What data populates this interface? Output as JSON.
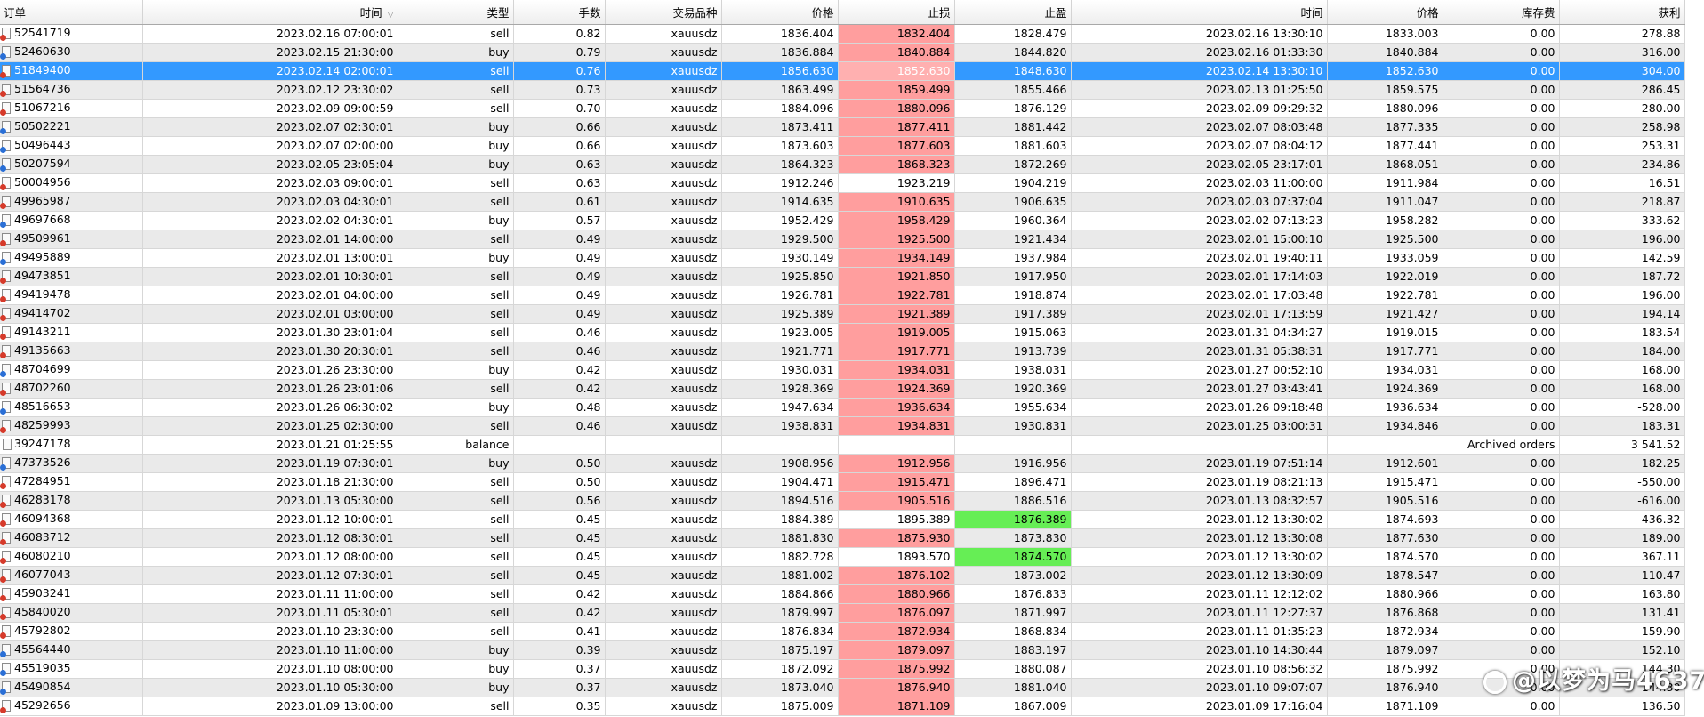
{
  "columns": [
    {
      "key": "order",
      "label": "订单"
    },
    {
      "key": "time",
      "label": "时间",
      "sort_icon": "sort-descending-icon"
    },
    {
      "key": "type",
      "label": "类型"
    },
    {
      "key": "lots",
      "label": "手数"
    },
    {
      "key": "symbol",
      "label": "交易品种"
    },
    {
      "key": "open_price",
      "label": "价格"
    },
    {
      "key": "sl",
      "label": "止损"
    },
    {
      "key": "tp",
      "label": "止盈"
    },
    {
      "key": "close_time",
      "label": "时间"
    },
    {
      "key": "close_price",
      "label": "价格"
    },
    {
      "key": "swap",
      "label": "库存费"
    },
    {
      "key": "profit",
      "label": "获利"
    }
  ],
  "colors": {
    "selected_row": "#3399ff",
    "stop_loss_hit": "#ff9e9e",
    "take_profit_hit": "#66ee55",
    "alternate_row": "#eaeaea"
  },
  "rows": [
    {
      "order": "52541719",
      "time": "2023.02.16 07:00:01",
      "type": "sell",
      "lots": "0.82",
      "symbol": "xauusdz",
      "open_price": "1836.404",
      "sl": "1832.404",
      "tp": "1828.479",
      "close_time": "2023.02.16 13:30:10",
      "close_price": "1833.003",
      "swap": "0.00",
      "profit": "278.88",
      "hit": "sl"
    },
    {
      "order": "52460630",
      "time": "2023.02.15 21:30:00",
      "type": "buy",
      "lots": "0.79",
      "symbol": "xauusdz",
      "open_price": "1836.884",
      "sl": "1840.884",
      "tp": "1844.820",
      "close_time": "2023.02.16 01:33:30",
      "close_price": "1840.884",
      "swap": "0.00",
      "profit": "316.00",
      "hit": "sl"
    },
    {
      "order": "51849400",
      "time": "2023.02.14 02:00:01",
      "type": "sell",
      "lots": "0.76",
      "symbol": "xauusdz",
      "open_price": "1856.630",
      "sl": "1852.630",
      "tp": "1848.630",
      "close_time": "2023.02.14 13:30:10",
      "close_price": "1852.630",
      "swap": "0.00",
      "profit": "304.00",
      "hit": "sl",
      "selected": true
    },
    {
      "order": "51564736",
      "time": "2023.02.12 23:30:02",
      "type": "sell",
      "lots": "0.73",
      "symbol": "xauusdz",
      "open_price": "1863.499",
      "sl": "1859.499",
      "tp": "1855.466",
      "close_time": "2023.02.13 01:25:50",
      "close_price": "1859.575",
      "swap": "0.00",
      "profit": "286.45",
      "hit": "sl"
    },
    {
      "order": "51067216",
      "time": "2023.02.09 09:00:59",
      "type": "sell",
      "lots": "0.70",
      "symbol": "xauusdz",
      "open_price": "1884.096",
      "sl": "1880.096",
      "tp": "1876.129",
      "close_time": "2023.02.09 09:29:32",
      "close_price": "1880.096",
      "swap": "0.00",
      "profit": "280.00",
      "hit": "sl"
    },
    {
      "order": "50502221",
      "time": "2023.02.07 02:30:01",
      "type": "buy",
      "lots": "0.66",
      "symbol": "xauusdz",
      "open_price": "1873.411",
      "sl": "1877.411",
      "tp": "1881.442",
      "close_time": "2023.02.07 08:03:48",
      "close_price": "1877.335",
      "swap": "0.00",
      "profit": "258.98",
      "hit": "sl"
    },
    {
      "order": "50496443",
      "time": "2023.02.07 02:00:00",
      "type": "buy",
      "lots": "0.66",
      "symbol": "xauusdz",
      "open_price": "1873.603",
      "sl": "1877.603",
      "tp": "1881.603",
      "close_time": "2023.02.07 08:04:12",
      "close_price": "1877.441",
      "swap": "0.00",
      "profit": "253.31",
      "hit": "sl"
    },
    {
      "order": "50207594",
      "time": "2023.02.05 23:05:04",
      "type": "buy",
      "lots": "0.63",
      "symbol": "xauusdz",
      "open_price": "1864.323",
      "sl": "1868.323",
      "tp": "1872.269",
      "close_time": "2023.02.05 23:17:01",
      "close_price": "1868.051",
      "swap": "0.00",
      "profit": "234.86",
      "hit": "sl"
    },
    {
      "order": "50004956",
      "time": "2023.02.03 09:00:01",
      "type": "sell",
      "lots": "0.63",
      "symbol": "xauusdz",
      "open_price": "1912.246",
      "sl": "1923.219",
      "tp": "1904.219",
      "close_time": "2023.02.03 11:00:00",
      "close_price": "1911.984",
      "swap": "0.00",
      "profit": "16.51",
      "hit": ""
    },
    {
      "order": "49965987",
      "time": "2023.02.03 04:30:01",
      "type": "sell",
      "lots": "0.61",
      "symbol": "xauusdz",
      "open_price": "1914.635",
      "sl": "1910.635",
      "tp": "1906.635",
      "close_time": "2023.02.03 07:37:04",
      "close_price": "1911.047",
      "swap": "0.00",
      "profit": "218.87",
      "hit": "sl"
    },
    {
      "order": "49697668",
      "time": "2023.02.02 04:30:01",
      "type": "buy",
      "lots": "0.57",
      "symbol": "xauusdz",
      "open_price": "1952.429",
      "sl": "1958.429",
      "tp": "1960.364",
      "close_time": "2023.02.02 07:13:23",
      "close_price": "1958.282",
      "swap": "0.00",
      "profit": "333.62",
      "hit": "sl"
    },
    {
      "order": "49509961",
      "time": "2023.02.01 14:00:00",
      "type": "sell",
      "lots": "0.49",
      "symbol": "xauusdz",
      "open_price": "1929.500",
      "sl": "1925.500",
      "tp": "1921.434",
      "close_time": "2023.02.01 15:00:10",
      "close_price": "1925.500",
      "swap": "0.00",
      "profit": "196.00",
      "hit": "sl"
    },
    {
      "order": "49495889",
      "time": "2023.02.01 13:00:01",
      "type": "buy",
      "lots": "0.49",
      "symbol": "xauusdz",
      "open_price": "1930.149",
      "sl": "1934.149",
      "tp": "1937.984",
      "close_time": "2023.02.01 19:40:11",
      "close_price": "1933.059",
      "swap": "0.00",
      "profit": "142.59",
      "hit": "sl"
    },
    {
      "order": "49473851",
      "time": "2023.02.01 10:30:01",
      "type": "sell",
      "lots": "0.49",
      "symbol": "xauusdz",
      "open_price": "1925.850",
      "sl": "1921.850",
      "tp": "1917.950",
      "close_time": "2023.02.01 17:14:03",
      "close_price": "1922.019",
      "swap": "0.00",
      "profit": "187.72",
      "hit": "sl"
    },
    {
      "order": "49419478",
      "time": "2023.02.01 04:00:00",
      "type": "sell",
      "lots": "0.49",
      "symbol": "xauusdz",
      "open_price": "1926.781",
      "sl": "1922.781",
      "tp": "1918.874",
      "close_time": "2023.02.01 17:03:48",
      "close_price": "1922.781",
      "swap": "0.00",
      "profit": "196.00",
      "hit": "sl"
    },
    {
      "order": "49414702",
      "time": "2023.02.01 03:00:00",
      "type": "sell",
      "lots": "0.49",
      "symbol": "xauusdz",
      "open_price": "1925.389",
      "sl": "1921.389",
      "tp": "1917.389",
      "close_time": "2023.02.01 17:13:59",
      "close_price": "1921.427",
      "swap": "0.00",
      "profit": "194.14",
      "hit": "sl"
    },
    {
      "order": "49143211",
      "time": "2023.01.30 23:01:04",
      "type": "sell",
      "lots": "0.46",
      "symbol": "xauusdz",
      "open_price": "1923.005",
      "sl": "1919.005",
      "tp": "1915.063",
      "close_time": "2023.01.31 04:34:27",
      "close_price": "1919.015",
      "swap": "0.00",
      "profit": "183.54",
      "hit": "sl"
    },
    {
      "order": "49135663",
      "time": "2023.01.30 20:30:01",
      "type": "sell",
      "lots": "0.46",
      "symbol": "xauusdz",
      "open_price": "1921.771",
      "sl": "1917.771",
      "tp": "1913.739",
      "close_time": "2023.01.31 05:38:31",
      "close_price": "1917.771",
      "swap": "0.00",
      "profit": "184.00",
      "hit": "sl"
    },
    {
      "order": "48704699",
      "time": "2023.01.26 23:30:00",
      "type": "buy",
      "lots": "0.42",
      "symbol": "xauusdz",
      "open_price": "1930.031",
      "sl": "1934.031",
      "tp": "1938.031",
      "close_time": "2023.01.27 00:52:10",
      "close_price": "1934.031",
      "swap": "0.00",
      "profit": "168.00",
      "hit": "sl"
    },
    {
      "order": "48702260",
      "time": "2023.01.26 23:01:06",
      "type": "sell",
      "lots": "0.42",
      "symbol": "xauusdz",
      "open_price": "1928.369",
      "sl": "1924.369",
      "tp": "1920.369",
      "close_time": "2023.01.27 03:43:41",
      "close_price": "1924.369",
      "swap": "0.00",
      "profit": "168.00",
      "hit": "sl"
    },
    {
      "order": "48516653",
      "time": "2023.01.26 06:30:02",
      "type": "buy",
      "lots": "0.48",
      "symbol": "xauusdz",
      "open_price": "1947.634",
      "sl": "1936.634",
      "tp": "1955.634",
      "close_time": "2023.01.26 09:18:48",
      "close_price": "1936.634",
      "swap": "0.00",
      "profit": "-528.00",
      "hit": "sl"
    },
    {
      "order": "48259993",
      "time": "2023.01.25 02:30:00",
      "type": "sell",
      "lots": "0.46",
      "symbol": "xauusdz",
      "open_price": "1938.831",
      "sl": "1934.831",
      "tp": "1930.831",
      "close_time": "2023.01.25 03:00:31",
      "close_price": "1934.846",
      "swap": "0.00",
      "profit": "183.31",
      "hit": "sl"
    },
    {
      "order": "39247178",
      "time": "2023.01.21 01:25:55",
      "type": "balance",
      "lots": "",
      "symbol": "",
      "open_price": "",
      "sl": "",
      "tp": "",
      "close_time": "",
      "close_price": "",
      "swap": "Archived orders",
      "profit": "3 541.52",
      "hit": ""
    },
    {
      "order": "47373526",
      "time": "2023.01.19 07:30:01",
      "type": "buy",
      "lots": "0.50",
      "symbol": "xauusdz",
      "open_price": "1908.956",
      "sl": "1912.956",
      "tp": "1916.956",
      "close_time": "2023.01.19 07:51:14",
      "close_price": "1912.601",
      "swap": "0.00",
      "profit": "182.25",
      "hit": "sl"
    },
    {
      "order": "47284951",
      "time": "2023.01.18 21:30:00",
      "type": "sell",
      "lots": "0.50",
      "symbol": "xauusdz",
      "open_price": "1904.471",
      "sl": "1915.471",
      "tp": "1896.471",
      "close_time": "2023.01.19 08:21:13",
      "close_price": "1915.471",
      "swap": "0.00",
      "profit": "-550.00",
      "hit": "sl"
    },
    {
      "order": "46283178",
      "time": "2023.01.13 05:30:00",
      "type": "sell",
      "lots": "0.56",
      "symbol": "xauusdz",
      "open_price": "1894.516",
      "sl": "1905.516",
      "tp": "1886.516",
      "close_time": "2023.01.13 08:32:57",
      "close_price": "1905.516",
      "swap": "0.00",
      "profit": "-616.00",
      "hit": "sl"
    },
    {
      "order": "46094368",
      "time": "2023.01.12 10:00:01",
      "type": "sell",
      "lots": "0.45",
      "symbol": "xauusdz",
      "open_price": "1884.389",
      "sl": "1895.389",
      "tp": "1876.389",
      "close_time": "2023.01.12 13:30:02",
      "close_price": "1874.693",
      "swap": "0.00",
      "profit": "436.32",
      "hit": "tp"
    },
    {
      "order": "46083712",
      "time": "2023.01.12 08:30:01",
      "type": "sell",
      "lots": "0.45",
      "symbol": "xauusdz",
      "open_price": "1881.830",
      "sl": "1875.930",
      "tp": "1873.830",
      "close_time": "2023.01.12 13:30:08",
      "close_price": "1877.630",
      "swap": "0.00",
      "profit": "189.00",
      "hit": "sl"
    },
    {
      "order": "46080210",
      "time": "2023.01.12 08:00:00",
      "type": "sell",
      "lots": "0.45",
      "symbol": "xauusdz",
      "open_price": "1882.728",
      "sl": "1893.570",
      "tp": "1874.570",
      "close_time": "2023.01.12 13:30:02",
      "close_price": "1874.570",
      "swap": "0.00",
      "profit": "367.11",
      "hit": "tp"
    },
    {
      "order": "46077043",
      "time": "2023.01.12 07:30:01",
      "type": "sell",
      "lots": "0.45",
      "symbol": "xauusdz",
      "open_price": "1881.002",
      "sl": "1876.102",
      "tp": "1873.002",
      "close_time": "2023.01.12 13:30:09",
      "close_price": "1878.547",
      "swap": "0.00",
      "profit": "110.47",
      "hit": "sl"
    },
    {
      "order": "45903241",
      "time": "2023.01.11 11:00:00",
      "type": "sell",
      "lots": "0.42",
      "symbol": "xauusdz",
      "open_price": "1884.866",
      "sl": "1880.966",
      "tp": "1876.833",
      "close_time": "2023.01.11 12:12:02",
      "close_price": "1880.966",
      "swap": "0.00",
      "profit": "163.80",
      "hit": "sl"
    },
    {
      "order": "45840020",
      "time": "2023.01.11 05:30:01",
      "type": "sell",
      "lots": "0.42",
      "symbol": "xauusdz",
      "open_price": "1879.997",
      "sl": "1876.097",
      "tp": "1871.997",
      "close_time": "2023.01.11 12:27:37",
      "close_price": "1876.868",
      "swap": "0.00",
      "profit": "131.41",
      "hit": "sl"
    },
    {
      "order": "45792802",
      "time": "2023.01.10 23:30:00",
      "type": "sell",
      "lots": "0.41",
      "symbol": "xauusdz",
      "open_price": "1876.834",
      "sl": "1872.934",
      "tp": "1868.834",
      "close_time": "2023.01.11 01:35:23",
      "close_price": "1872.934",
      "swap": "0.00",
      "profit": "159.90",
      "hit": "sl"
    },
    {
      "order": "45564440",
      "time": "2023.01.10 11:00:00",
      "type": "buy",
      "lots": "0.39",
      "symbol": "xauusdz",
      "open_price": "1875.197",
      "sl": "1879.097",
      "tp": "1883.197",
      "close_time": "2023.01.10 14:30:44",
      "close_price": "1879.097",
      "swap": "0.00",
      "profit": "152.10",
      "hit": "sl"
    },
    {
      "order": "45519035",
      "time": "2023.01.10 08:00:00",
      "type": "buy",
      "lots": "0.37",
      "symbol": "xauusdz",
      "open_price": "1872.092",
      "sl": "1875.992",
      "tp": "1880.087",
      "close_time": "2023.01.10 08:56:32",
      "close_price": "1875.992",
      "swap": "0.00",
      "profit": "144.30",
      "hit": "sl"
    },
    {
      "order": "45490854",
      "time": "2023.01.10 05:30:00",
      "type": "buy",
      "lots": "0.37",
      "symbol": "xauusdz",
      "open_price": "1873.040",
      "sl": "1876.940",
      "tp": "1881.040",
      "close_time": "2023.01.10 09:07:07",
      "close_price": "1876.940",
      "swap": "0.00",
      "profit": "144.30",
      "hit": "sl"
    },
    {
      "order": "45292656",
      "time": "2023.01.09 13:00:00",
      "type": "sell",
      "lots": "0.35",
      "symbol": "xauusdz",
      "open_price": "1875.009",
      "sl": "1871.109",
      "tp": "1867.009",
      "close_time": "2023.01.09 17:16:04",
      "close_price": "1871.109",
      "swap": "0.00",
      "profit": "136.50",
      "hit": "sl"
    }
  ],
  "watermark": {
    "text": "@以梦为马4637",
    "logo_icon": "weibo-logo-icon"
  }
}
